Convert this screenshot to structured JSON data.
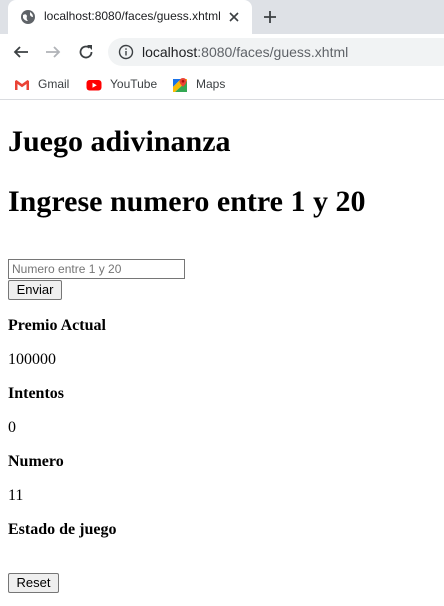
{
  "browser": {
    "tab": {
      "title": "localhost:8080/faces/guess.xhtml"
    },
    "address": {
      "host": "localhost",
      "rest": ":8080/faces/guess.xhtml"
    },
    "bookmarks": [
      {
        "label": "Gmail",
        "icon": "gmail-icon"
      },
      {
        "label": "YouTube",
        "icon": "youtube-icon"
      },
      {
        "label": "Maps",
        "icon": "maps-icon"
      }
    ]
  },
  "page": {
    "title": "Juego adivinanza",
    "prompt": "Ingrese numero entre 1 y 20",
    "input": {
      "placeholder": "Numero entre 1 y 20",
      "value": ""
    },
    "send_label": "Enviar",
    "stats": {
      "premio_label": "Premio Actual",
      "premio_value": "100000",
      "intentos_label": "Intentos",
      "intentos_value": "0",
      "numero_label": "Numero",
      "numero_value": "11",
      "estado_label": "Estado de juego",
      "estado_value": ""
    },
    "reset_label": "Reset"
  },
  "colors": {
    "tabstrip": "#dee1e6",
    "omnibox": "#f1f3f4",
    "youtube_red": "#ff0000",
    "gmail_red": "#ea4335"
  }
}
